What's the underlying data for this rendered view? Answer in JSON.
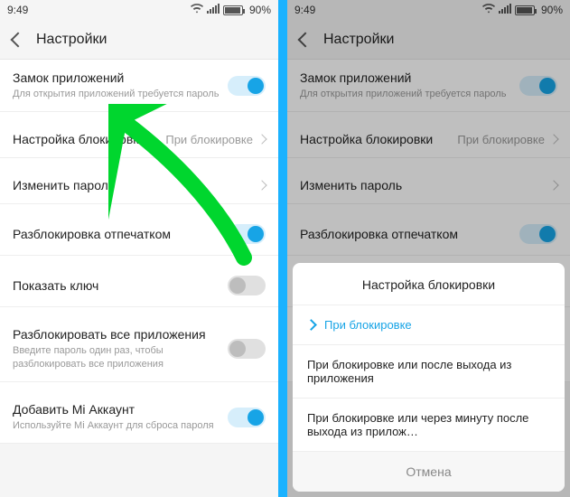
{
  "status": {
    "time": "9:49",
    "battery": "90%"
  },
  "header": {
    "title": "Настройки"
  },
  "rows": {
    "app_lock": {
      "title": "Замок приложений",
      "sub": "Для открытия приложений требуется пароль"
    },
    "lock_setting": {
      "title": "Настройка блокировки",
      "value": "При блокировке"
    },
    "change_pw": {
      "title": "Изменить пароль"
    },
    "fingerprint": {
      "title": "Разблокировка отпечатком"
    },
    "show_key": {
      "title": "Показать ключ"
    },
    "unlock_all": {
      "title": "Разблокировать все приложения",
      "sub": "Введите пароль один раз, чтобы разблокировать все приложения"
    },
    "mi_account": {
      "title": "Добавить Mi Аккаунт",
      "sub": "Используйте Mi Аккаунт для сброса пароля"
    }
  },
  "sheet": {
    "title": "Настройка блокировки",
    "opt1": "При блокировке",
    "opt2": "При блокировке или после выхода из приложения",
    "opt3": "При блокировке или через минуту после выхода из прилож…",
    "cancel": "Отмена"
  }
}
